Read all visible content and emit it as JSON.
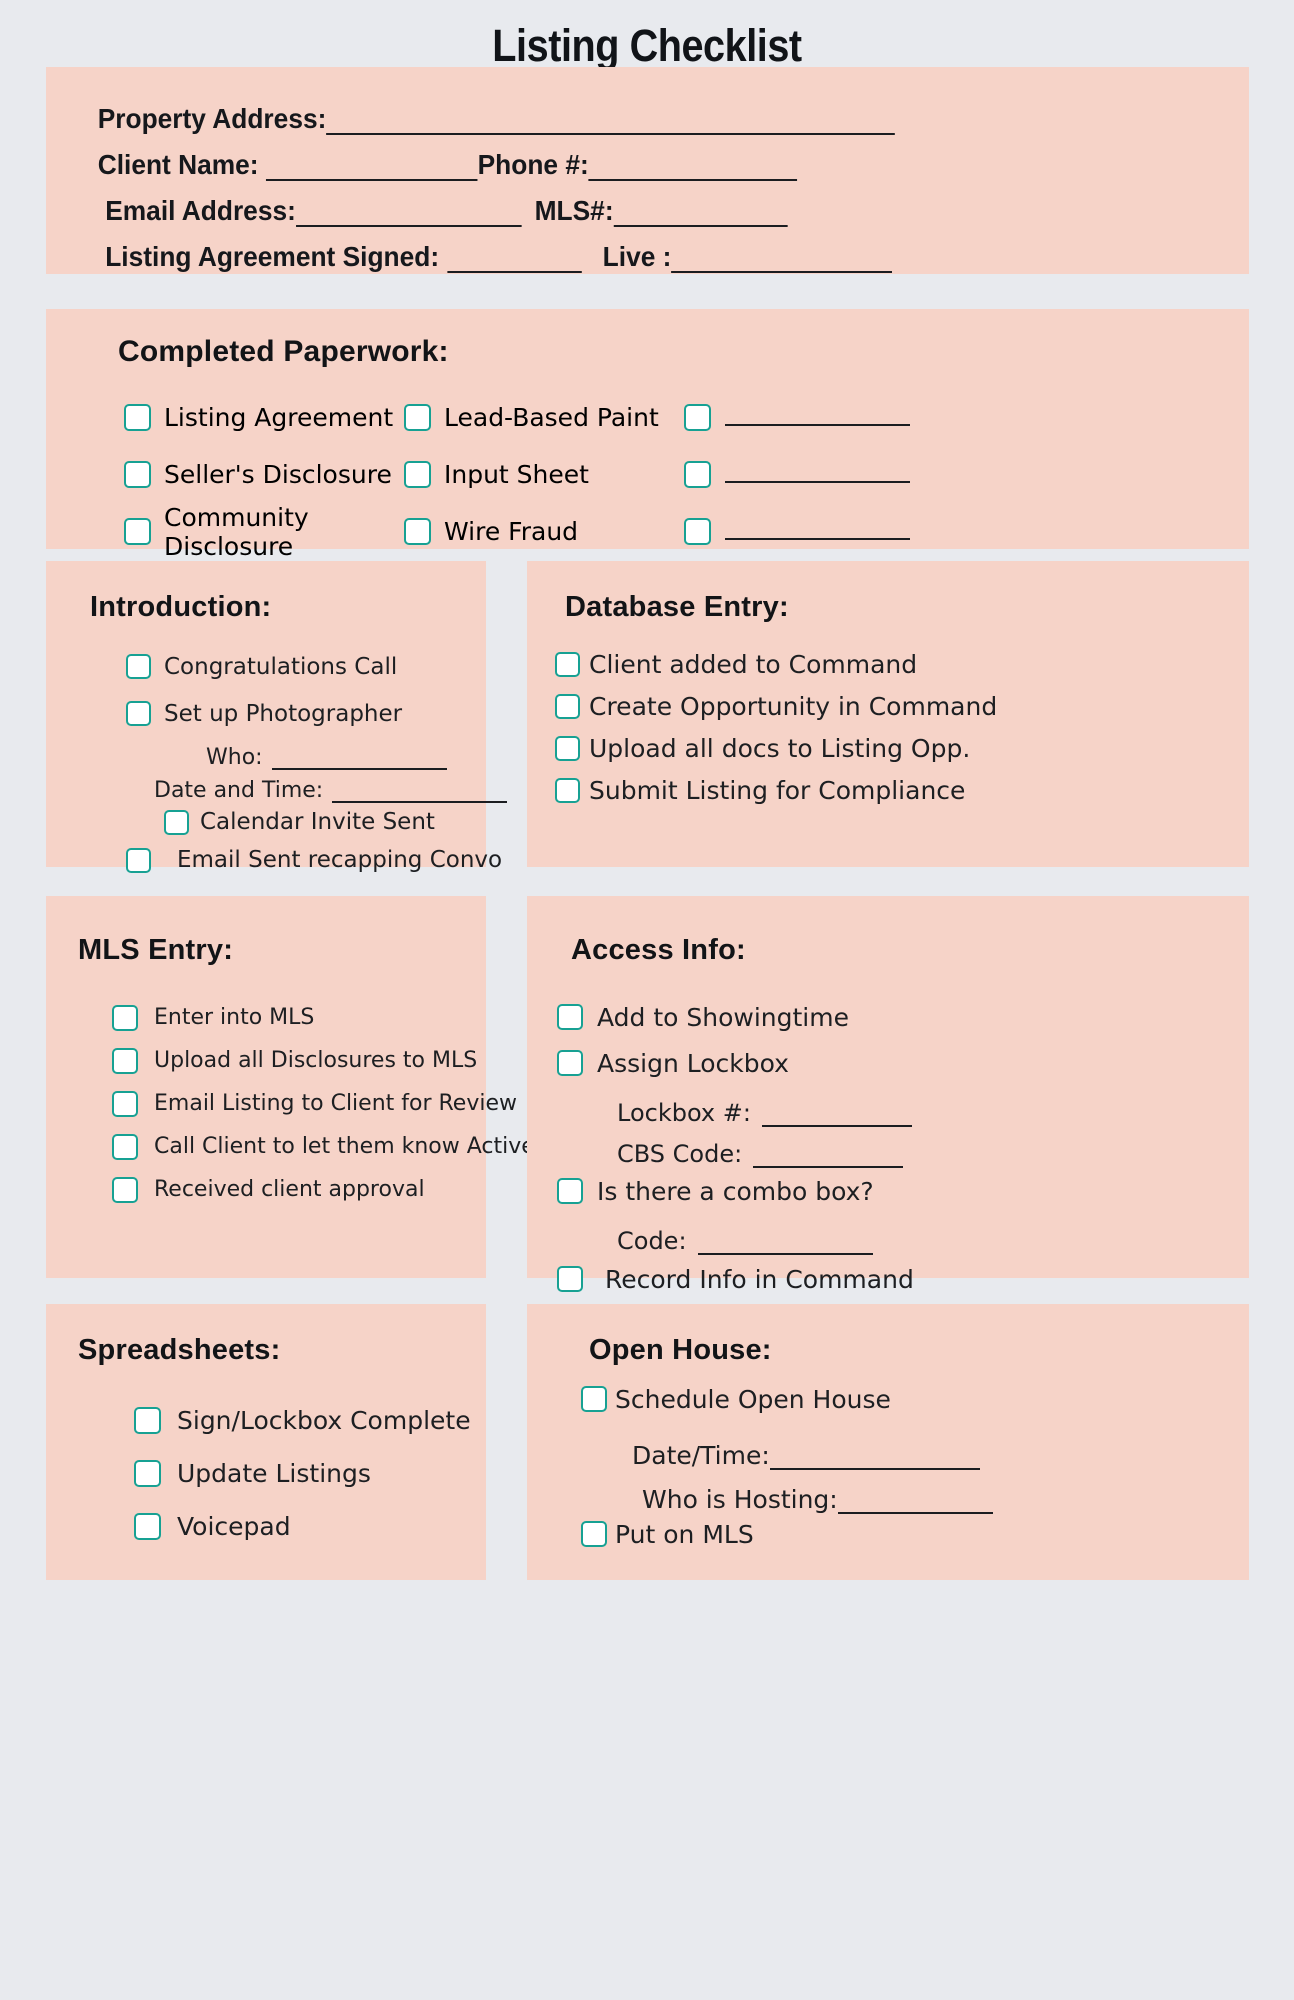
{
  "theme": {
    "page_bg": "#e8eaee",
    "card_bg": "#f6d3c8",
    "checkbox_border": "#17a193",
    "checkbox_fill": "#ffffff",
    "text": "#1d1f22"
  },
  "title": "Listing Checklist",
  "header": {
    "rows": [
      {
        "label": "Property Address:",
        "blank_width": 605
      },
      {
        "label": "Client Name:",
        "blank_width": 225,
        "label2": "Phone #:",
        "blank2_width": 222
      },
      {
        "label": "Email Address:",
        "blank_width": 240,
        "label2": "MLS#:",
        "blank2_width": 185
      },
      {
        "label": "Listing Agreement Signed:",
        "blank_width": 143,
        "label2": "Live :",
        "blank2_width": 235
      }
    ]
  },
  "paperwork": {
    "heading": "Completed Paperwork:",
    "rows": [
      {
        "col1": "Listing Agreement",
        "col2": "Lead-Based Paint",
        "col3": ""
      },
      {
        "col1": "Seller's Disclosure",
        "col2": "Input Sheet",
        "col3": ""
      },
      {
        "col1": "Community Disclosure",
        "col2": "Wire Fraud",
        "col3": ""
      }
    ]
  },
  "introduction": {
    "heading": "Introduction:",
    "items": [
      "Congratulations Call",
      "Set up Photographer"
    ],
    "who_label": "Who:",
    "date_time_label": "Date and Time:",
    "calendar_item": "Calendar Invite Sent",
    "email_item": "Email Sent recapping Convo"
  },
  "database_entry": {
    "heading": "Database Entry:",
    "items": [
      "Client added to Command",
      "Create Opportunity in Command",
      "Upload all docs to Listing Opp.",
      "Submit Listing for Compliance"
    ]
  },
  "mls_entry": {
    "heading": "MLS Entry:",
    "items": [
      "Enter into MLS",
      "Upload all Disclosures to MLS",
      "Email Listing to Client for Review",
      "Call Client to let them know Active",
      "Received client approval"
    ]
  },
  "access_info": {
    "heading": "Access Info:",
    "item1": "Add to Showingtime",
    "item2": "Assign Lockbox",
    "lockbox_label": "Lockbox #:",
    "cbs_label": "CBS Code:",
    "combo_item": "Is there a combo box?",
    "code_label": "Code:",
    "record_item": "Record Info in Command"
  },
  "spreadsheets": {
    "heading": "Spreadsheets:",
    "items": [
      "Sign/Lockbox Complete",
      "Update Listings",
      "Voicepad"
    ]
  },
  "open_house": {
    "heading": "Open House:",
    "item1": "Schedule Open House",
    "date_time_label": "Date/Time:",
    "who_hosting_label": "Who is Hosting:",
    "item2": "Put on MLS"
  }
}
